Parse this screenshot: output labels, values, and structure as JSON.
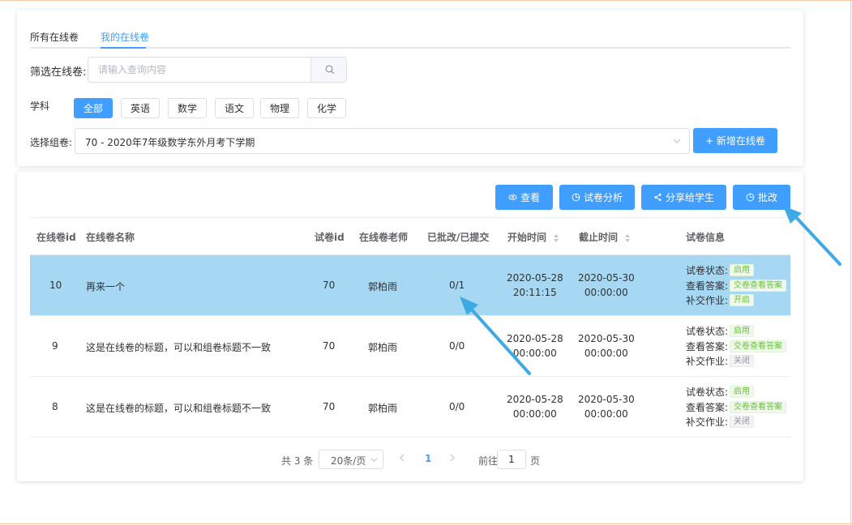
{
  "tabs": [
    {
      "label": "所有在线卷"
    },
    {
      "label": "我的在线卷"
    }
  ],
  "filter": {
    "label": "筛选在线卷:",
    "placeholder": "请输入查询内容"
  },
  "subject": {
    "label": "学科",
    "options": [
      "全部",
      "英语",
      "数学",
      "语文",
      "物理",
      "化学"
    ],
    "active": "全部"
  },
  "group": {
    "label": "选择组卷:",
    "value": "70 - 2020年7年级数学东外月考下学期"
  },
  "add_button": "+ 新增在线卷",
  "toolbar": {
    "view": "查看",
    "analysis": "试卷分析",
    "share": "分享给学生",
    "grade": "批改"
  },
  "table": {
    "headers": [
      "在线卷id",
      "在线卷名称",
      "试卷id",
      "在线卷老师",
      "已批改/已提交",
      "开始时间",
      "截止时间",
      "试卷信息"
    ],
    "rows": [
      {
        "id": "10",
        "name": "再来一个",
        "paper_id": "70",
        "teacher": "郭柏雨",
        "graded": "0/1",
        "start_date": "2020-05-28",
        "start_time": "20:11:15",
        "end_date": "2020-05-30",
        "end_time": "00:00:00",
        "status_label": "试卷状态:",
        "status_tag": "启用",
        "answer_label": "查看答案:",
        "answer_tag": "交卷查看答案",
        "makeup_label": "补交作业:",
        "makeup_tag": "开启"
      },
      {
        "id": "9",
        "name": "这是在线卷的标题，可以和组卷标题不一致",
        "paper_id": "70",
        "teacher": "郭柏雨",
        "graded": "0/0",
        "start_date": "2020-05-28",
        "start_time": "00:00:00",
        "end_date": "2020-05-30",
        "end_time": "00:00:00",
        "status_label": "试卷状态:",
        "status_tag": "启用",
        "answer_label": "查看答案:",
        "answer_tag": "交卷查看答案",
        "makeup_label": "补交作业:",
        "makeup_tag": "关闭"
      },
      {
        "id": "8",
        "name": "这是在线卷的标题，可以和组卷标题不一致",
        "paper_id": "70",
        "teacher": "郭柏雨",
        "graded": "0/0",
        "start_date": "2020-05-28",
        "start_time": "00:00:00",
        "end_date": "2020-05-30",
        "end_time": "00:00:00",
        "status_label": "试卷状态:",
        "status_tag": "启用",
        "answer_label": "查看答案:",
        "answer_tag": "交卷查看答案",
        "makeup_label": "补交作业:",
        "makeup_tag": "关闭"
      }
    ]
  },
  "pagination": {
    "total": "共 3 条",
    "page_size": "20条/页",
    "current": "1",
    "goto_label": "前往",
    "goto_value": "1",
    "goto_unit": "页"
  },
  "colors": {
    "primary": "#409eff",
    "selected_row": "#a6d8f3",
    "annotation_arrow": "#3fa9e6"
  }
}
